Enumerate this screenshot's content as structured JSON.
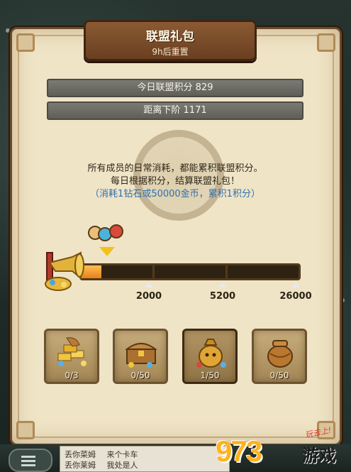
{
  "header": {
    "title": "联盟礼包",
    "subtitle": "9h后重置"
  },
  "stats": {
    "today_points": "今日联盟积分 829",
    "next_tier": "距离下阶 1171"
  },
  "description": {
    "line1": "所有成员的日常消耗，都能累积联盟积分。",
    "line2": "每日根据积分，结算联盟礼包！",
    "line3": "（消耗1钻石或50000金币，累积1积分）"
  },
  "progress": {
    "current": 829,
    "max": 26000,
    "fill_fraction": 0.09,
    "milestones": [
      "2000",
      "5200",
      "26000"
    ]
  },
  "rewards": [
    {
      "count": "0/3",
      "icon": "gold-bars-icon"
    },
    {
      "count": "0/50",
      "icon": "treasure-chest-icon"
    },
    {
      "count": "1/50",
      "icon": "money-bag-icon"
    },
    {
      "count": "0/50",
      "icon": "clay-jar-icon"
    }
  ],
  "chat": {
    "messages": [
      {
        "sender": "丢你菜姆",
        "text": "来个卡车"
      },
      {
        "sender": "丢你莱姆",
        "text": "我处是人"
      }
    ]
  },
  "watermark": {
    "digits": "973",
    "tag": "玩去上!",
    "name": "游戏"
  },
  "colors": {
    "parchment": "#efe4c6",
    "wood": "#6a3f20",
    "progress_fill": "#e6801a",
    "highlight_text": "#2f6fb0",
    "watermark_orange": "#ffb21d"
  }
}
